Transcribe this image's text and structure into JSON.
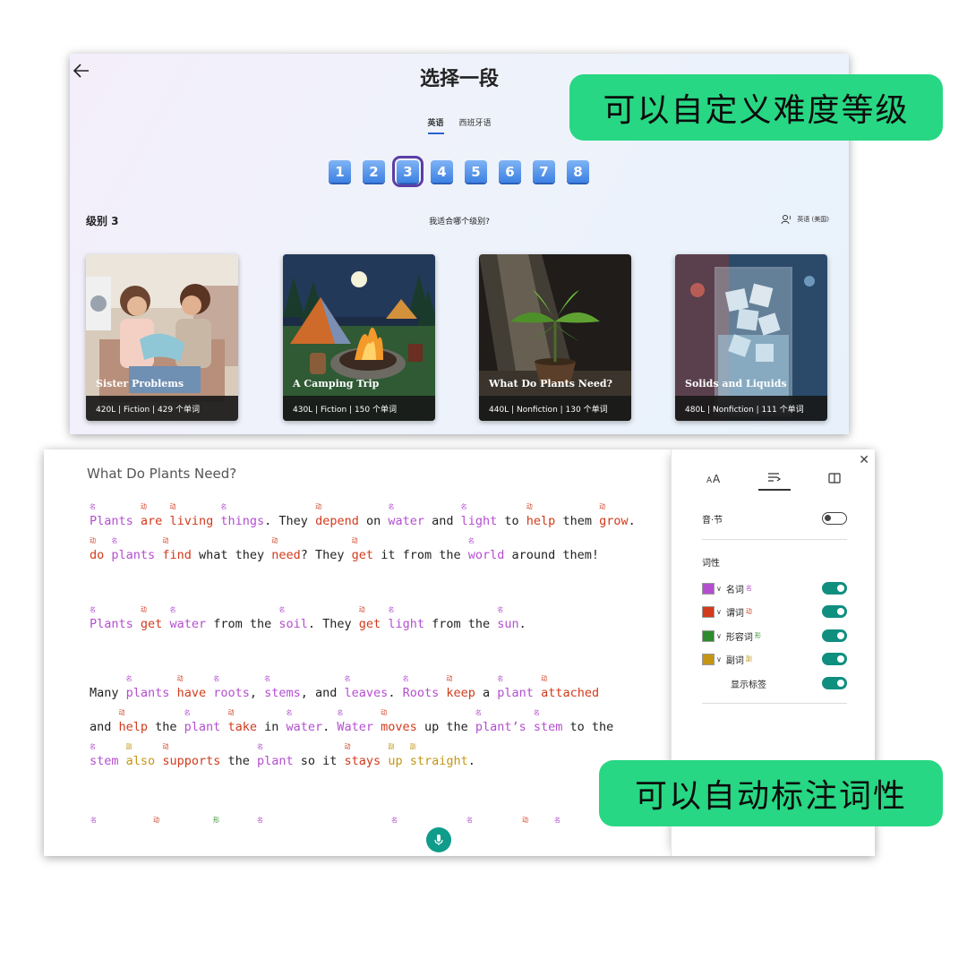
{
  "top": {
    "title": "选择一段",
    "tabs": [
      "英语",
      "西班牙语"
    ],
    "levels": [
      "1",
      "2",
      "3",
      "4",
      "5",
      "6",
      "7",
      "8"
    ],
    "selected_level": "3",
    "level_label": "级别 3",
    "level_help": "我适合哪个级别?",
    "locale": "英语 (美国)",
    "cards": [
      {
        "title": "Sister Problems",
        "lexile": "420L",
        "genre": "Fiction",
        "words": "429 个单词"
      },
      {
        "title": "A Camping Trip",
        "lexile": "430L",
        "genre": "Fiction",
        "words": "150 个单词"
      },
      {
        "title": "What Do Plants Need?",
        "lexile": "440L",
        "genre": "Nonfiction",
        "words": "130 个单词"
      },
      {
        "title": "Solids and Liquids",
        "lexile": "480L",
        "genre": "Nonfiction",
        "words": "111 个单词"
      }
    ]
  },
  "callouts": {
    "difficulty": "可以自定义难度等级",
    "pos": "可以自动标注词性"
  },
  "reader": {
    "title": "What Do Plants Need?",
    "tags": {
      "noun": "名",
      "verb": "动",
      "adj": "形",
      "adv": "副"
    }
  },
  "panel": {
    "syllable_label": "音·节",
    "pos_label": "词性",
    "rows": [
      {
        "label": "名词",
        "tag": "名",
        "color": "#b44ed0"
      },
      {
        "label": "谓词",
        "tag": "动",
        "color": "#d23a1c"
      },
      {
        "label": "形容词",
        "tag": "形",
        "color": "#2d8a2d"
      },
      {
        "label": "副词",
        "tag": "副",
        "color": "#c49614"
      }
    ],
    "show_labels": "显示标签"
  },
  "colors": {
    "accent": "#0f8f80",
    "callout": "#27d783",
    "level_blue": "#3d81e3"
  }
}
